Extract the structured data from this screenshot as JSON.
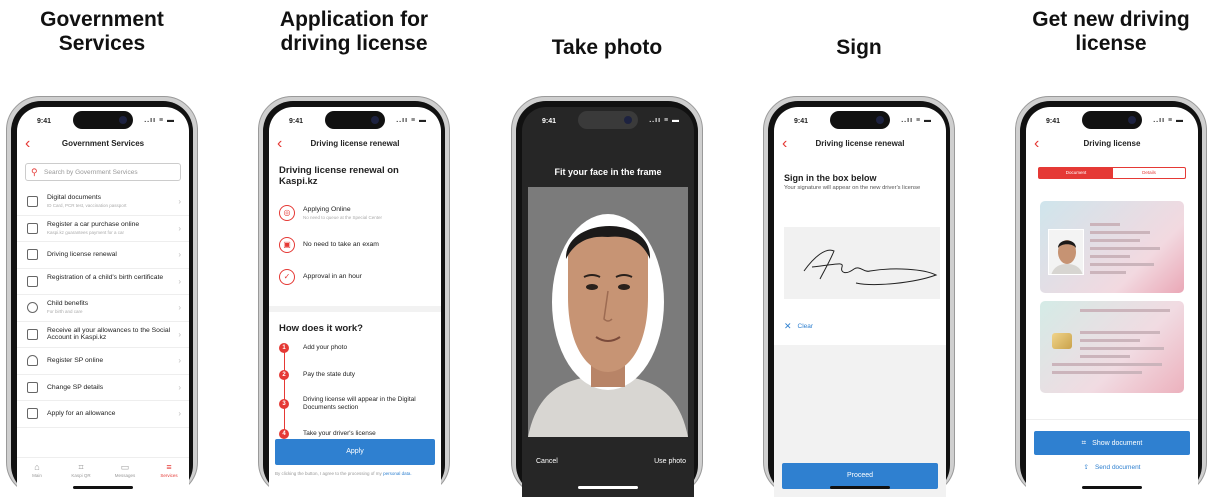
{
  "steps": [
    {
      "title_l1": "Government",
      "title_l2": "Services"
    },
    {
      "title_l1": "Application for",
      "title_l2": "driving license"
    },
    {
      "title": "Take photo"
    },
    {
      "title": "Sign"
    },
    {
      "title_l1": "Get new driving",
      "title_l2": "license"
    }
  ],
  "status": {
    "time": "9:41",
    "signal": "..ıı ≡ ▬"
  },
  "screen1": {
    "title": "Government Services",
    "search_placeholder": "Search by Government Services",
    "items": [
      {
        "label": "Digital documents",
        "sub": "ID Card, PCR test, vaccination passport",
        "icon": "document-icon"
      },
      {
        "label": "Register a car purchase online",
        "sub": "Kaspi.kz guarantees payment for a car",
        "icon": "car-icon"
      },
      {
        "label": "Driving license renewal",
        "sub": "",
        "icon": "license-icon"
      },
      {
        "label": "Registration of a child's birth certificate",
        "sub": "",
        "icon": "certificate-icon"
      },
      {
        "label": "Child benefits",
        "sub": "For birth and care",
        "icon": "baby-icon"
      },
      {
        "label": "Receive all your allowances to the Social Account in Kaspi.kz",
        "sub": "",
        "icon": "allowance-icon"
      },
      {
        "label": "Register SP online",
        "sub": "",
        "icon": "person-icon"
      },
      {
        "label": "Change SP details",
        "sub": "",
        "icon": "edit-icon"
      },
      {
        "label": "Apply for an allowance",
        "sub": "",
        "icon": "form-icon"
      }
    ],
    "tabs": [
      {
        "label": "Main",
        "icon": "home-icon"
      },
      {
        "label": "Kaspi QR",
        "icon": "qr-icon"
      },
      {
        "label": "Messages",
        "icon": "message-icon"
      },
      {
        "label": "Services",
        "icon": "menu-icon"
      }
    ]
  },
  "screen2": {
    "title": "Driving license renewal",
    "heading": "Driving license renewal on Kaspi.kz",
    "features": [
      {
        "title": "Applying Online",
        "sub": "No need to queue at the Special Center"
      },
      {
        "title": "No need to take an exam",
        "sub": ""
      },
      {
        "title": "Approval in an hour",
        "sub": ""
      }
    ],
    "how_title": "How does it work?",
    "steps": [
      {
        "num": "1",
        "text": "Add your photo"
      },
      {
        "num": "2",
        "text": "Pay the state duty"
      },
      {
        "num": "3",
        "text": "Driving license will appear in the Digital Documents section"
      },
      {
        "num": "4",
        "text": "Take your driver's license"
      }
    ],
    "apply_label": "Apply",
    "consent_text": "By clicking the button, I agree to the processing of my",
    "consent_link": "personal data."
  },
  "screen3": {
    "title": "Fit your face in the frame",
    "cancel_label": "Cancel",
    "use_label": "Use photo"
  },
  "screen4": {
    "title": "Driving license renewal",
    "heading": "Sign in the box below",
    "subtext": "Your signature will appear on the new driver's license",
    "clear_label": "Clear",
    "proceed_label": "Proceed"
  },
  "screen5": {
    "title": "Driving license",
    "tab_document": "Document",
    "tab_details": "Details",
    "show_label": "Show document",
    "send_label": "Send document"
  },
  "colors": {
    "accent_red": "#e53935",
    "button_blue": "#2f80d0"
  }
}
